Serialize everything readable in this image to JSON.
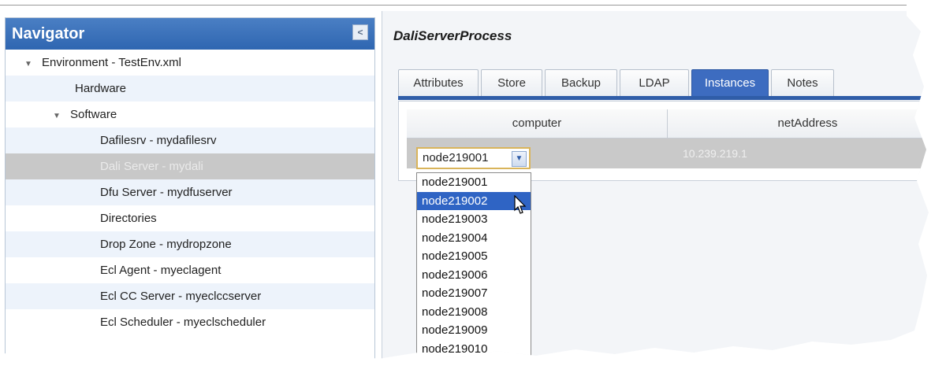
{
  "navigator": {
    "title": "Navigator",
    "collapse_glyph": "<",
    "items": [
      {
        "label": "Environment - TestEnv.xml",
        "indent": 0,
        "expanded": true
      },
      {
        "label": "Hardware",
        "indent": 1,
        "expanded": false
      },
      {
        "label": "Software",
        "indent": 1,
        "expanded": true
      },
      {
        "label": "Dafilesrv - mydafilesrv",
        "indent": 2
      },
      {
        "label": "Dali Server - mydali",
        "indent": 2,
        "selected": true
      },
      {
        "label": "Dfu Server - mydfuserver",
        "indent": 2
      },
      {
        "label": "Directories",
        "indent": 2
      },
      {
        "label": "Drop Zone - mydropzone",
        "indent": 2
      },
      {
        "label": "Ecl Agent - myeclagent",
        "indent": 2
      },
      {
        "label": "Ecl CC Server - myeclccserver",
        "indent": 2
      },
      {
        "label": "Ecl Scheduler - myeclscheduler",
        "indent": 2
      }
    ]
  },
  "main": {
    "title": "DaliServerProcess",
    "tabs": [
      {
        "label": "Attributes"
      },
      {
        "label": "Store"
      },
      {
        "label": "Backup"
      },
      {
        "label": "LDAP"
      },
      {
        "label": "Instances",
        "active": true
      },
      {
        "label": "Notes"
      }
    ],
    "grid": {
      "columns": [
        "computer",
        "netAddress"
      ],
      "row": {
        "computer": "node219001",
        "netAddress": "10.239.219.1"
      }
    },
    "dropdown": {
      "selected": "node219001",
      "highlighted": "node219002",
      "options": [
        "node219001",
        "node219002",
        "node219003",
        "node219004",
        "node219005",
        "node219006",
        "node219007",
        "node219008",
        "node219009",
        "node219010"
      ]
    }
  },
  "colors": {
    "accent": "#2f64c4",
    "header": "#3d6cc0",
    "selected_row": "#c8c8c8",
    "alt_row": "#edf3fb"
  }
}
